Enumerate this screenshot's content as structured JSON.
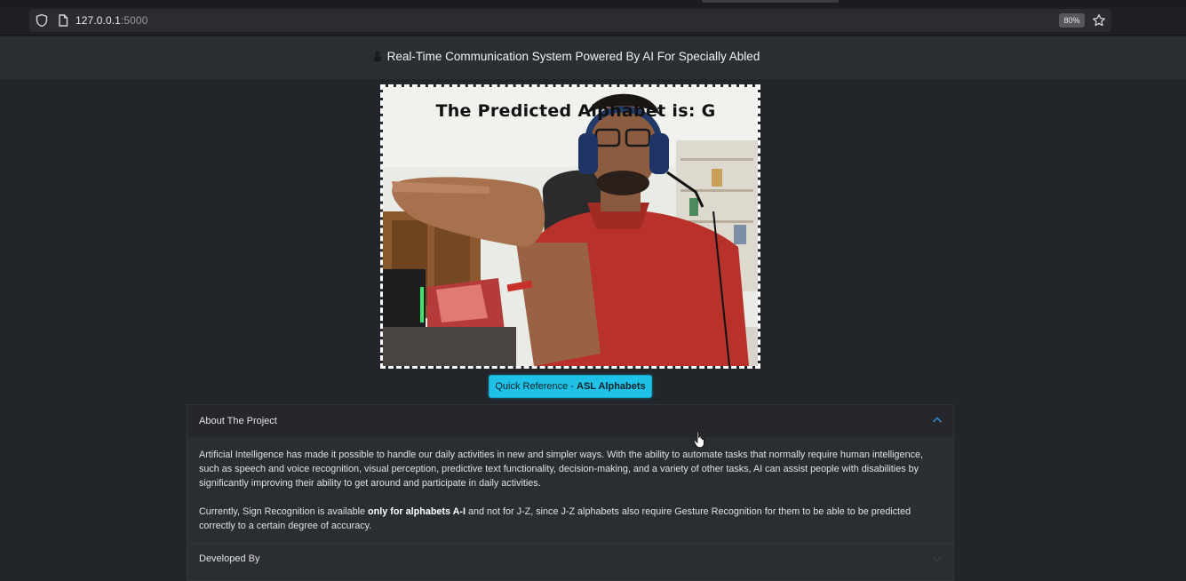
{
  "browser": {
    "url_host": "127.0.0.1",
    "url_port": ":5000",
    "zoom": "80%"
  },
  "header": {
    "title": "Real-Time Communication System Powered By AI For Specially Abled"
  },
  "video": {
    "prediction_text": "The Predicted Alphabet is: G"
  },
  "reference_button": {
    "prefix": "Quick Reference - ",
    "bold": "ASL Alphabets"
  },
  "accordion": {
    "items": [
      {
        "title": "About The Project",
        "expanded": true,
        "paragraph1": "Artificial Intelligence has made it possible to handle our daily activities in new and simpler ways. With the ability to automate tasks that normally require human intelligence, such as speech and voice recognition, visual perception, predictive text functionality, decision-making, and a variety of other tasks, AI can assist people with disabilities by significantly improving their ability to get around and participate in daily activities.",
        "paragraph2_before": "Currently, Sign Recognition is available ",
        "paragraph2_bold": "only for alphabets A-I",
        "paragraph2_after": " and not for J-Z, since J-Z alphabets also require Gesture Recognition for them to be able to be predicted correctly to a certain degree of accuracy."
      },
      {
        "title": "Developed By",
        "expanded": false
      }
    ]
  },
  "colors": {
    "accent": "#1fc2e6",
    "page_bg": "#22252a"
  }
}
